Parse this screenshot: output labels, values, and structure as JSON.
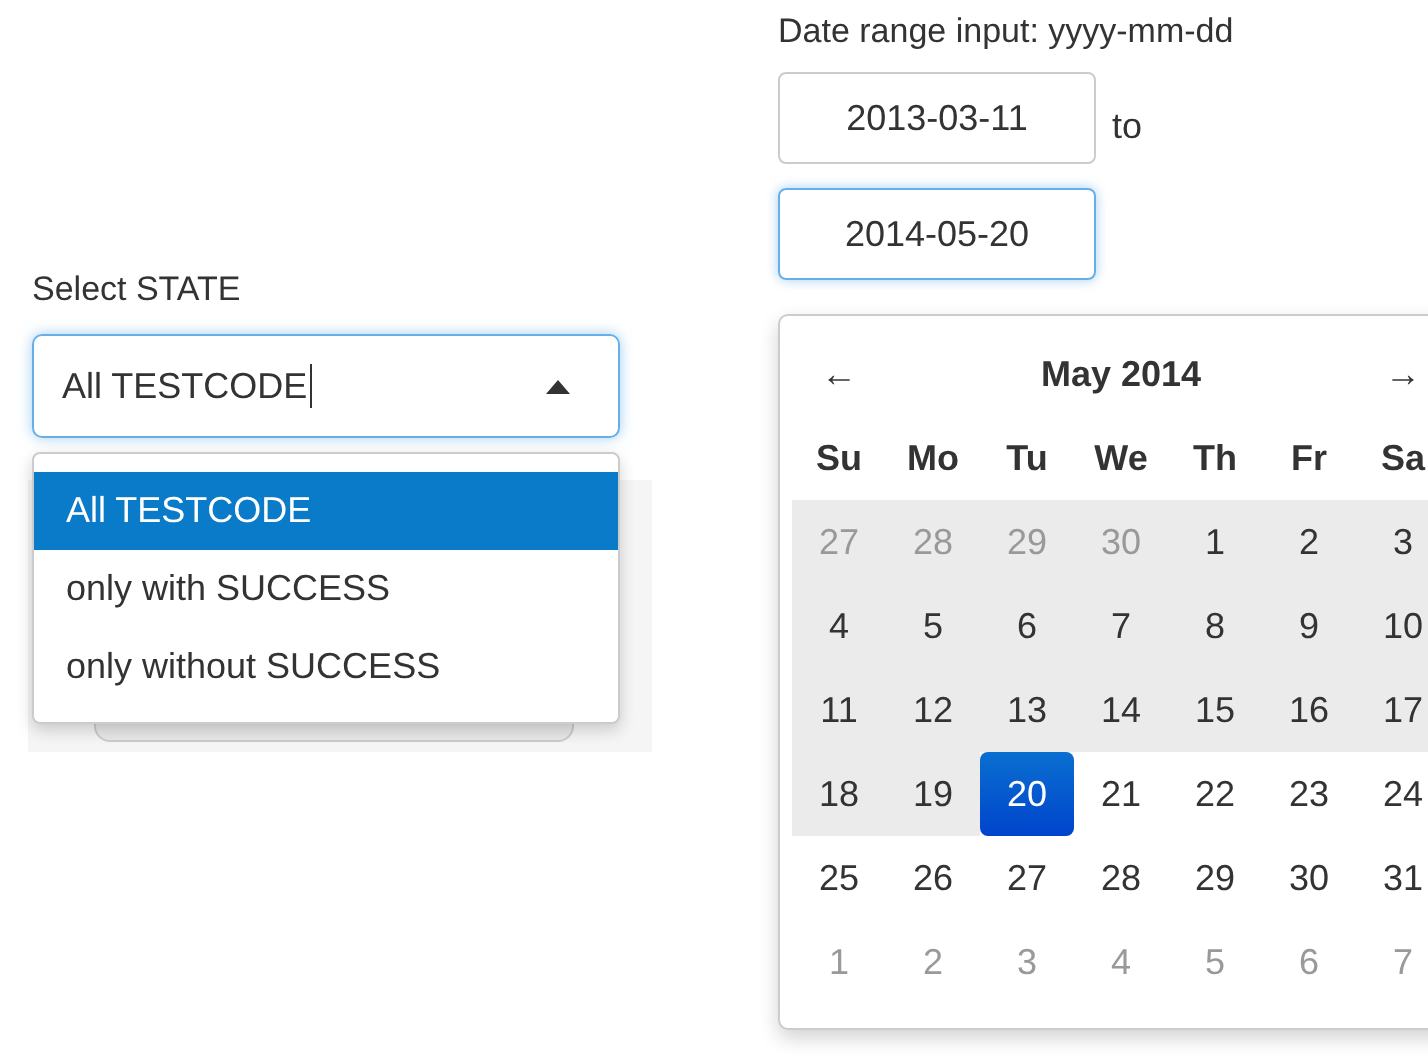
{
  "state_select": {
    "label": "Select STATE",
    "value": "All TESTCODE",
    "expanded": true,
    "options": [
      {
        "label": "All TESTCODE",
        "selected": true
      },
      {
        "label": "only with SUCCESS",
        "selected": false
      },
      {
        "label": "only without SUCCESS",
        "selected": false
      }
    ]
  },
  "date_range": {
    "label": "Date range input: yyyy-mm-dd",
    "start": "2013-03-11",
    "separator": "to",
    "end": "2014-05-20",
    "calendar": {
      "prev": "←",
      "title": "May 2014",
      "next": "→",
      "weekdays": [
        "Su",
        "Mo",
        "Tu",
        "We",
        "Th",
        "Fr",
        "Sa"
      ],
      "weeks": [
        [
          {
            "day": "27",
            "muted": true,
            "in_range": true,
            "selected": false
          },
          {
            "day": "28",
            "muted": true,
            "in_range": true,
            "selected": false
          },
          {
            "day": "29",
            "muted": true,
            "in_range": true,
            "selected": false
          },
          {
            "day": "30",
            "muted": true,
            "in_range": true,
            "selected": false
          },
          {
            "day": "1",
            "muted": false,
            "in_range": true,
            "selected": false
          },
          {
            "day": "2",
            "muted": false,
            "in_range": true,
            "selected": false
          },
          {
            "day": "3",
            "muted": false,
            "in_range": true,
            "selected": false
          }
        ],
        [
          {
            "day": "4",
            "muted": false,
            "in_range": true,
            "selected": false
          },
          {
            "day": "5",
            "muted": false,
            "in_range": true,
            "selected": false
          },
          {
            "day": "6",
            "muted": false,
            "in_range": true,
            "selected": false
          },
          {
            "day": "7",
            "muted": false,
            "in_range": true,
            "selected": false
          },
          {
            "day": "8",
            "muted": false,
            "in_range": true,
            "selected": false
          },
          {
            "day": "9",
            "muted": false,
            "in_range": true,
            "selected": false
          },
          {
            "day": "10",
            "muted": false,
            "in_range": true,
            "selected": false
          }
        ],
        [
          {
            "day": "11",
            "muted": false,
            "in_range": true,
            "selected": false
          },
          {
            "day": "12",
            "muted": false,
            "in_range": true,
            "selected": false
          },
          {
            "day": "13",
            "muted": false,
            "in_range": true,
            "selected": false
          },
          {
            "day": "14",
            "muted": false,
            "in_range": true,
            "selected": false
          },
          {
            "day": "15",
            "muted": false,
            "in_range": true,
            "selected": false
          },
          {
            "day": "16",
            "muted": false,
            "in_range": true,
            "selected": false
          },
          {
            "day": "17",
            "muted": false,
            "in_range": true,
            "selected": false
          }
        ],
        [
          {
            "day": "18",
            "muted": false,
            "in_range": true,
            "selected": false
          },
          {
            "day": "19",
            "muted": false,
            "in_range": true,
            "selected": false
          },
          {
            "day": "20",
            "muted": false,
            "in_range": false,
            "selected": true
          },
          {
            "day": "21",
            "muted": false,
            "in_range": false,
            "selected": false
          },
          {
            "day": "22",
            "muted": false,
            "in_range": false,
            "selected": false
          },
          {
            "day": "23",
            "muted": false,
            "in_range": false,
            "selected": false
          },
          {
            "day": "24",
            "muted": false,
            "in_range": false,
            "selected": false
          }
        ],
        [
          {
            "day": "25",
            "muted": false,
            "in_range": false,
            "selected": false
          },
          {
            "day": "26",
            "muted": false,
            "in_range": false,
            "selected": false
          },
          {
            "day": "27",
            "muted": false,
            "in_range": false,
            "selected": false
          },
          {
            "day": "28",
            "muted": false,
            "in_range": false,
            "selected": false
          },
          {
            "day": "29",
            "muted": false,
            "in_range": false,
            "selected": false
          },
          {
            "day": "30",
            "muted": false,
            "in_range": false,
            "selected": false
          },
          {
            "day": "31",
            "muted": false,
            "in_range": false,
            "selected": false
          }
        ],
        [
          {
            "day": "1",
            "muted": true,
            "in_range": false,
            "selected": false
          },
          {
            "day": "2",
            "muted": true,
            "in_range": false,
            "selected": false
          },
          {
            "day": "3",
            "muted": true,
            "in_range": false,
            "selected": false
          },
          {
            "day": "4",
            "muted": true,
            "in_range": false,
            "selected": false
          },
          {
            "day": "5",
            "muted": true,
            "in_range": false,
            "selected": false
          },
          {
            "day": "6",
            "muted": true,
            "in_range": false,
            "selected": false
          },
          {
            "day": "7",
            "muted": true,
            "in_range": false,
            "selected": false
          }
        ]
      ]
    }
  }
}
